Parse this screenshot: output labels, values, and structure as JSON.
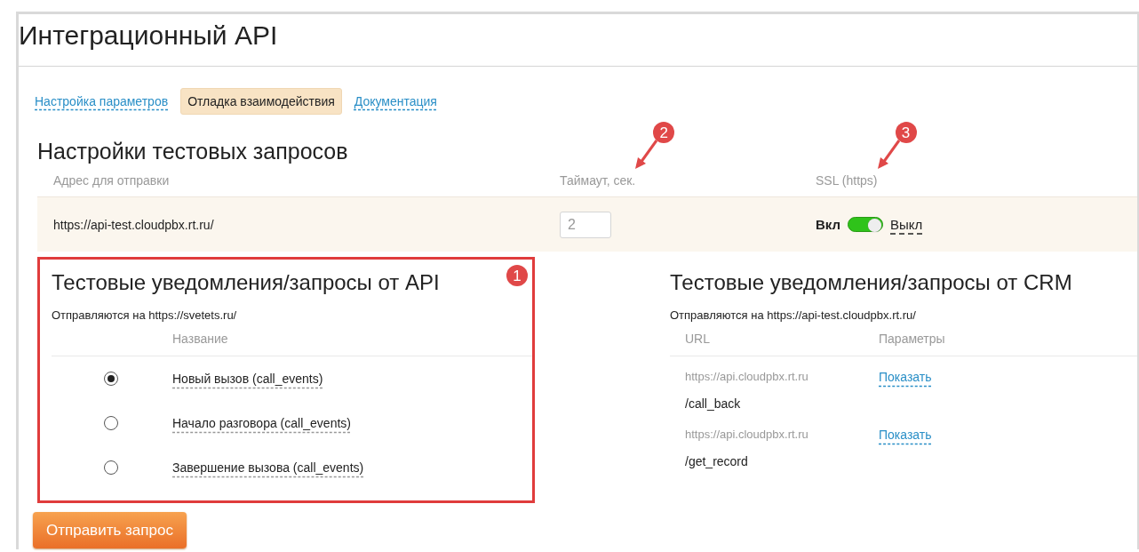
{
  "page": {
    "title": "Интеграционный API"
  },
  "tabs": [
    {
      "label": "Настройка параметров",
      "selected": false
    },
    {
      "label": "Отладка взаимодействия",
      "selected": true
    },
    {
      "label": "Документация",
      "selected": false
    }
  ],
  "settings": {
    "title": "Настройки тестовых запросов",
    "columns": [
      {
        "label": "Адрес для отправки"
      },
      {
        "label": "Таймаут, сек.",
        "badge": "2"
      },
      {
        "label": "SSL (https)",
        "badge": "3"
      }
    ],
    "address": "https://api-test.cloudpbx.rt.ru/",
    "timeout": "2",
    "ssl": {
      "on_label": "Вкл",
      "off_label": "Выкл",
      "on": true
    }
  },
  "api_panel": {
    "title": "Тестовые уведомления/запросы от API",
    "badge": "1",
    "highlighted": true,
    "subtitle": "Отправляются на https://svetets.ru/",
    "column": "Название",
    "items": [
      {
        "label": "Новый вызов (call_events)",
        "selected": true
      },
      {
        "label": "Начало разговора (call_events)",
        "selected": false
      },
      {
        "label": "Завершение вызова (call_events)",
        "selected": false
      }
    ]
  },
  "crm_panel": {
    "title": "Тестовые уведомления/запросы от CRM",
    "subtitle": "Отправляются на https://api-test.cloudpbx.rt.ru/",
    "columns": [
      "URL",
      "Параметры"
    ],
    "rows": [
      {
        "host": "https://api.cloudpbx.rt.ru",
        "path": "/call_back",
        "action": "Показать"
      },
      {
        "host": "https://api.cloudpbx.rt.ru",
        "path": "/get_record",
        "action": "Показать"
      }
    ]
  },
  "send_button": "Отправить запрос"
}
